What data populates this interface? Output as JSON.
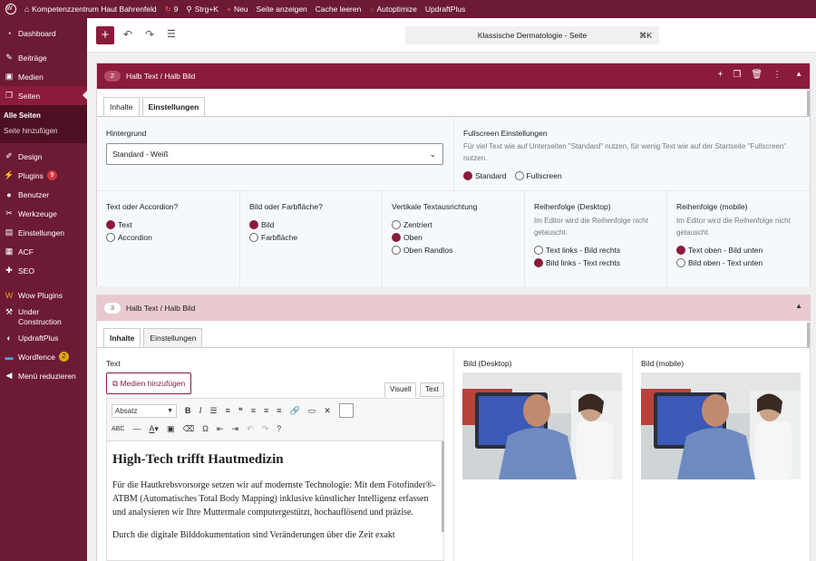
{
  "adminbar": {
    "site": "Kompetenzzentrum Haut Bahrenfeld",
    "updates": "9",
    "shortcut": "Strg+K",
    "new": "Neu",
    "view": "Seite anzeigen",
    "cache": "Cache leeren",
    "autoptimize": "Autoptimize",
    "updraft": "UpdraftPlus"
  },
  "sidebar": {
    "dashboard": "Dashboard",
    "posts": "Beiträge",
    "media": "Medien",
    "pages": "Seiten",
    "all_pages": "Alle Seiten",
    "add_page": "Seite hinzufügen",
    "design": "Design",
    "plugins": "Plugins",
    "plugins_count": "9",
    "users": "Benutzer",
    "tools": "Werkzeuge",
    "settings": "Einstellungen",
    "acf": "ACF",
    "seo": "SEO",
    "wow": "Wow Plugins",
    "under": "Under Construction",
    "updraft": "UpdraftPlus",
    "wordfence": "Wordfence",
    "wordfence_count": "2",
    "collapse": "Menü reduzieren"
  },
  "editor": {
    "command": "Klassische Dermatologie - Seite",
    "command_key": "⌘K"
  },
  "block1": {
    "number": "2",
    "title": "Halb Text / Halb Bild",
    "tab_content": "Inhalte",
    "tab_settings": "Einstellungen",
    "bg_label": "Hintergrund",
    "bg_value": "Standard - Weiß",
    "fs_label": "Fullscreen Einstellungen",
    "fs_desc": "Für viel Text wie auf Unterseiten \"Standard\" nutzen, für wenig Text wie auf der Startseite \"Fullscreen\" nutzen.",
    "fs_opt1": "Standard",
    "fs_opt2": "Fullscreen",
    "c1_label": "Text oder Accordion?",
    "c1_opt1": "Text",
    "c1_opt2": "Accordion",
    "c2_label": "Bild oder Farbfläche?",
    "c2_opt1": "Bild",
    "c2_opt2": "Farbfläche",
    "c3_label": "Vertikale Textausrichtung",
    "c3_opt1": "Zentriert",
    "c3_opt2": "Oben",
    "c3_opt3": "Oben Randlos",
    "c4_label": "Reihenfolge (Desktop)",
    "c4_desc": "Im Editor wird die Reihenfolge nicht getauscht.",
    "c4_opt1": "Text links - Bild rechts",
    "c4_opt2": "Bild links - Text rechts",
    "c5_label": "Reihenfolge (mobile)",
    "c5_desc": "Im Editor wird die Reihenfolge nicht getauscht.",
    "c5_opt1": "Text oben - Bild unten",
    "c5_opt2": "Bild oben - Text unten"
  },
  "block2": {
    "number": "3",
    "title": "Halb Text / Halb Bild",
    "tab_content": "Inhalte",
    "tab_settings": "Einstellungen",
    "text_label": "Text",
    "add_media": "Medien hinzufügen",
    "visual": "Visuell",
    "text": "Text",
    "format": "Absatz",
    "img_desktop": "Bild (Desktop)",
    "img_mobile": "Bild (mobile)",
    "heading": "High-Tech trifft Hautmedizin",
    "p1": "Für die Hautkrebsvorsorge setzen wir auf modernste Technologie: Mit dem Fotofinder®-ATBM (Automatisches Total Body Mapping) inklusive künstlicher Intelligenz erfassen und analysieren wir Ihre Muttermale computergestützt, hochauflösend und präzise.",
    "p2": "Durch die digitale Bilddokumentation sind Veränderungen über die Zeit exakt"
  }
}
